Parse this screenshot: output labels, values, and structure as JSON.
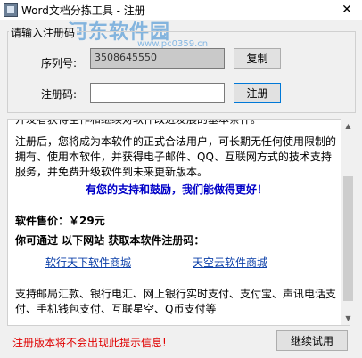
{
  "window": {
    "title": "Word文档分拣工具 - 注册",
    "close_glyph": "✕"
  },
  "watermark": {
    "text": "河东软件园",
    "url": "www.pc0359.cn"
  },
  "register_group": {
    "title": "请输入注册码",
    "serial_label": "序列号:",
    "serial_value": "3508645550",
    "copy_button": "复制",
    "code_label": "注册码:",
    "code_value": "",
    "register_button": "注册"
  },
  "info": {
    "cut_line": "开发者获得全作和继续对软件改进发展的基本条件。",
    "paragraph1": "注册后，您将成为本软件的正式合法用户，可长期无任何使用限制的拥有、使用本软件，并获得电子邮件、QQ、互联网方式的技术支持服务，并免费升级软件到未来更新版本。",
    "thanks": "有您的支持和鼓励，我们能做得更好！",
    "price": "软件售价：￥29元",
    "where": "你可通过  以下网站  获取本软件注册码：",
    "link1": "软行天下软件商城",
    "link2": "天空云软件商城",
    "payment": "支持邮局汇款、银行电汇、网上银行实时支付、支付宝、声讯电话支付、手机钱包支付、互联星空、Q币支付等"
  },
  "footer": {
    "warning": "注册版本将不会出现此提示信息!",
    "continue_button": "继续试用"
  }
}
